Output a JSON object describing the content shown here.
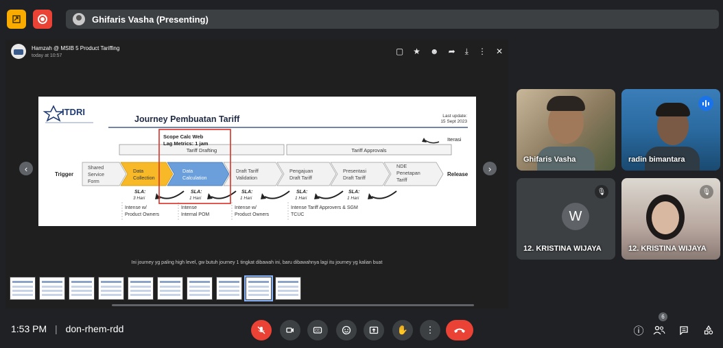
{
  "top_bar": {
    "presenter_label": "Ghifaris Vasha (Presenting)"
  },
  "chat_header": {
    "title": "Hamzah @ MSIB 5 Product Tariffing",
    "subtitle": "today at 10:57"
  },
  "slide": {
    "logo": "ITDRI",
    "title": "Journey Pembuatan Tariff",
    "update_label": "Last update:",
    "update_date": "15 Sept 2023",
    "scope_line1": "Scope Calc Web",
    "scope_line2": "Lag Metrics: 1 jam",
    "iterasi": "Iterasi",
    "phase_drafting": "Tariff Drafting",
    "phase_approvals": "Tariff Approvals",
    "trigger": "Trigger",
    "release": "Release",
    "steps": [
      {
        "lines": [
          "Shared",
          "Service",
          "Form"
        ]
      },
      {
        "lines": [
          "Data",
          "Collection"
        ]
      },
      {
        "lines": [
          "Data",
          "Calculation"
        ]
      },
      {
        "lines": [
          "Draft Tariff",
          "Validation"
        ]
      },
      {
        "lines": [
          "Pengajuan",
          "Draft Tariff"
        ]
      },
      {
        "lines": [
          "Presentasi",
          "Draft Tariff"
        ]
      },
      {
        "lines": [
          "NDE",
          "Penetapan",
          "Tariff"
        ]
      }
    ],
    "slas": [
      {
        "label": "SLA:",
        "value": "3 Hari"
      },
      {
        "label": "SLA:",
        "value": "1 Hari"
      },
      {
        "label": "SLA:",
        "value": "1 Hari"
      },
      {
        "label": "SLA:",
        "value": "1 Hari"
      },
      {
        "label": "SLA:",
        "value": "1 Hari"
      }
    ],
    "notes": [
      {
        "lines": [
          "Intense w/",
          "Product Owners"
        ]
      },
      {
        "lines": [
          "Intense",
          "Internal POM"
        ]
      },
      {
        "lines": [
          "Intense w/",
          "Product Owners"
        ]
      },
      {
        "lines": [
          "Intense Tariff Approvers & SGM",
          "TCUC"
        ]
      }
    ]
  },
  "caption": "Ini journey yg paling high level, gw butuh journey 1 tingkat dibawah ini, baru dibawahnya lagi itu journey yg kalian buat",
  "participants": [
    {
      "name": "Ghifaris Vasha"
    },
    {
      "name": "radin bimantara"
    },
    {
      "name": "12. KRISTINA WIJAYA",
      "initial": "W"
    },
    {
      "name": "12. KRISTINA WIJAYA"
    }
  ],
  "bottom_bar": {
    "time": "1:53 PM",
    "meeting_code": "don-rhem-rdd",
    "participant_count": "6"
  },
  "icons": {
    "pin": "pin-icon",
    "record": "record-icon",
    "mic_off": "mic-off-icon",
    "camera": "camera-icon",
    "captions": "captions-icon",
    "emoji": "emoji-icon",
    "present": "present-icon",
    "hand": "raise-hand-icon",
    "more": "more-vert-icon",
    "end_call": "end-call-icon",
    "info": "info-icon",
    "people": "people-icon",
    "chat": "chat-icon",
    "activities": "activities-icon"
  },
  "colors": {
    "accent_red": "#ea4335",
    "pin_yellow": "#f9ab00",
    "speaking_blue": "#1a73e8",
    "slide_orange": "#f7b928",
    "slide_blue": "#6a9fdc"
  }
}
